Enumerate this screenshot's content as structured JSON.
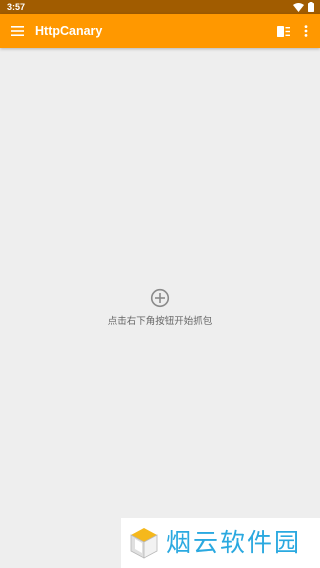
{
  "status_bar": {
    "time": "3:57",
    "icons": [
      "wifi-icon",
      "battery-icon"
    ]
  },
  "app_bar": {
    "title": "HttpCanary",
    "menu_icon": "menu-icon",
    "filter_icon": "filter-list-icon",
    "more_icon": "more-vert-icon",
    "color": "#ff9800"
  },
  "empty_state": {
    "icon": "add-circle-icon",
    "message": "点击右下角按钮开始抓包"
  },
  "watermark": {
    "text": "烟云软件园"
  },
  "colors": {
    "status_bar": "#a15c00",
    "background": "#eeeeee",
    "watermark_text": "#2aa9e0"
  }
}
